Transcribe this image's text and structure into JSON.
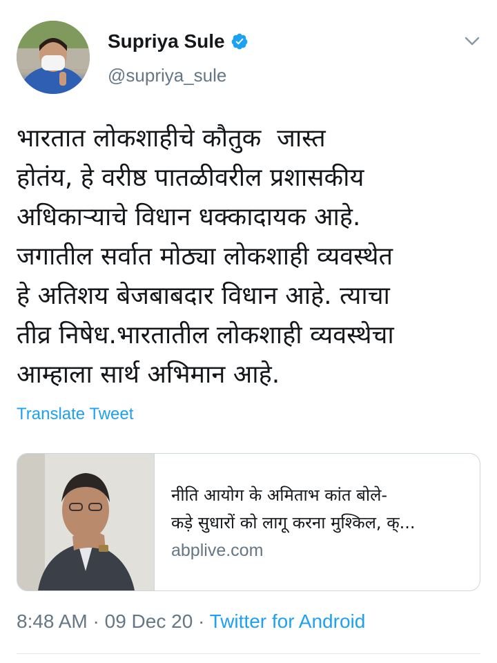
{
  "author": {
    "display_name": "Supriya Sule",
    "handle": "@supriya_sule",
    "verified": true
  },
  "tweet": {
    "lines": [
      "भारतात लोकशाहीचे कौतुक  जास्त",
      "होतंय, हे वरीष्ठ पातळीवरील प्रशासकीय",
      "अधिकाऱ्याचे विधान धक्कादायक आहे.",
      "जगातील सर्वात मोठ्या लोकशाही व्यवस्थेत",
      "हे अतिशय बेजबाबदार विधान आहे. त्याचा",
      "तीव्र निषेध.भारतातील लोकशाही व्यवस्थेचा",
      "आम्हाला सार्थ अभिमान आहे."
    ],
    "translate_label": "Translate Tweet"
  },
  "card": {
    "title_line1": "नीति आयोग के अमिताभ कांत बोले-",
    "title_line2": "कड़े सुधारों को लागू करना मुश्किल, क्...",
    "domain": "abplive.com"
  },
  "meta": {
    "time": "8:48 AM",
    "separator1": " · ",
    "date": "09 Dec 20",
    "separator2": " · ",
    "source": "Twitter for Android"
  },
  "colors": {
    "link": "#1da1f2",
    "secondary_text": "#657786",
    "primary_text": "#14171a",
    "border": "#ccd6dd"
  },
  "icons": {
    "verified": "verified-badge-icon",
    "caret": "chevron-down-icon"
  }
}
